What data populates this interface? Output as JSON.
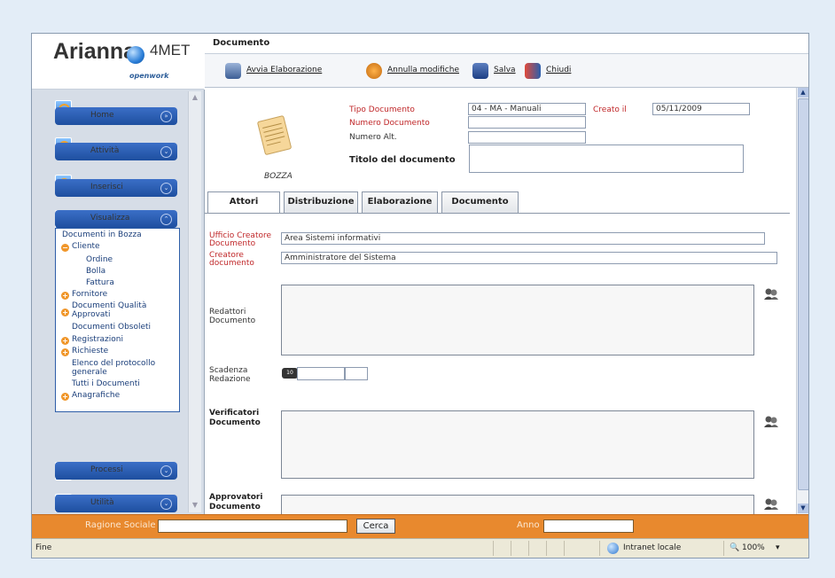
{
  "logo": {
    "main": "Arianna",
    "suffix": "4MET",
    "tagline": "openwork"
  },
  "window": {
    "title": "Documento"
  },
  "toolbar": {
    "avvia": "Avvia Elaborazione",
    "annulla": "Annulla modifiche",
    "salva": "Salva",
    "chiudi": "Chiudi"
  },
  "nav": {
    "home": "Home",
    "attivita": "Attività",
    "inserisci": "Inserisci",
    "visualizza": "Visualizza",
    "processi": "Processi",
    "utilita": "Utilità"
  },
  "submenu": {
    "bozza": "Documenti in Bozza",
    "cliente": "Cliente",
    "ordine": "Ordine",
    "bolla": "Bolla",
    "fattura": "Fattura",
    "fornitore": "Fornitore",
    "qualita_1": "Documenti Qualità",
    "qualita_2": "Approvati",
    "obsoleti": "Documenti Obsoleti",
    "registrazioni": "Registrazioni",
    "richieste": "Richieste",
    "elenco_1": "Elenco del protocollo",
    "elenco_2": "generale",
    "tutti": "Tutti i Documenti",
    "anagrafiche": "Anagrafiche"
  },
  "doc": {
    "status": "BOZZA",
    "tipo_label": "Tipo Documento",
    "tipo_value": "04 - MA - Manuali",
    "creato_label": "Creato il",
    "creato_value": "05/11/2009",
    "numero_label": "Numero Documento",
    "numero_value": "",
    "alt_label": "Numero Alt.",
    "alt_value": "",
    "titolo_label": "Titolo del documento",
    "titolo_value": ""
  },
  "tabs": {
    "attori": "Attori",
    "distribuzione": "Distribuzione",
    "elaborazione": "Elaborazione",
    "documento": "Documento"
  },
  "attori": {
    "ufficio_label_1": "Ufficio Creatore",
    "ufficio_label_2": "Documento",
    "ufficio_value": "Area Sistemi informativi",
    "creatore_label_1": "Creatore",
    "creatore_label_2": "documento",
    "creatore_value": "Amministratore del Sistema",
    "redattori_1": "Redattori",
    "redattori_2": "Documento",
    "scadenza_1": "Scadenza",
    "scadenza_2": "Redazione",
    "verificatori_1": "Verificatori",
    "verificatori_2": "Documento",
    "approvatori_1": "Approvatori",
    "approvatori_2": "Documento"
  },
  "search": {
    "ragione_label": "Ragione Sociale",
    "ragione_value": "",
    "cerca": "Cerca",
    "anno_label": "Anno",
    "anno_value": ""
  },
  "status": {
    "left": "Fine",
    "zone": "Intranet locale",
    "zoom": "100%"
  },
  "colors": {
    "nav_blue": "#1e4f9f",
    "search_orange": "#e8892e",
    "label_red": "#c0282a"
  }
}
